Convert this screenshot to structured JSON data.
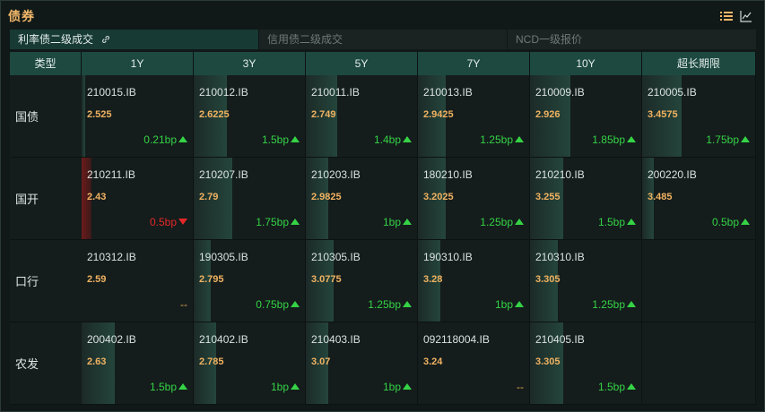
{
  "header": {
    "title": "债券",
    "icons": [
      "list-icon",
      "line-chart-icon"
    ]
  },
  "tabs": [
    {
      "label": "利率债二级成交",
      "active": true,
      "icon": "link-icon"
    },
    {
      "label": "信用债二级成交",
      "active": false
    },
    {
      "label": "NCD一级报价",
      "active": false
    }
  ],
  "columns": [
    "类型",
    "1Y",
    "3Y",
    "5Y",
    "7Y",
    "10Y",
    "超长期限"
  ],
  "rows": [
    {
      "label": "国债",
      "cells": [
        {
          "code": "210015.IB",
          "yield": "2.525",
          "change": "0.21bp",
          "dir": "up",
          "level": 0.03
        },
        {
          "code": "210012.IB",
          "yield": "2.6225",
          "change": "1.5bp",
          "dir": "up",
          "level": 0.3
        },
        {
          "code": "210011.IB",
          "yield": "2.749",
          "change": "1.4bp",
          "dir": "up",
          "level": 0.28
        },
        {
          "code": "210013.IB",
          "yield": "2.9425",
          "change": "1.25bp",
          "dir": "up",
          "level": 0.25
        },
        {
          "code": "210009.IB",
          "yield": "2.926",
          "change": "1.85bp",
          "dir": "up",
          "level": 0.36
        },
        {
          "code": "210005.IB",
          "yield": "3.4575",
          "change": "1.75bp",
          "dir": "up",
          "level": 0.35
        }
      ]
    },
    {
      "label": "国开",
      "cells": [
        {
          "code": "210211.IB",
          "yield": "2.43",
          "change": "0.5bp",
          "dir": "down",
          "level": 0.09
        },
        {
          "code": "210207.IB",
          "yield": "2.79",
          "change": "1.75bp",
          "dir": "up",
          "level": 0.35
        },
        {
          "code": "210203.IB",
          "yield": "2.9825",
          "change": "1bp",
          "dir": "up",
          "level": 0.2
        },
        {
          "code": "180210.IB",
          "yield": "3.2025",
          "change": "1.25bp",
          "dir": "up",
          "level": 0.25
        },
        {
          "code": "210210.IB",
          "yield": "3.255",
          "change": "1.5bp",
          "dir": "up",
          "level": 0.3
        },
        {
          "code": "200220.IB",
          "yield": "3.485",
          "change": "0.5bp",
          "dir": "up",
          "level": 0.1
        }
      ]
    },
    {
      "label": "口行",
      "cells": [
        {
          "code": "210312.IB",
          "yield": "2.59",
          "change": "--",
          "dir": "flat",
          "level": 0
        },
        {
          "code": "190305.IB",
          "yield": "2.795",
          "change": "0.75bp",
          "dir": "up",
          "level": 0.15
        },
        {
          "code": "210305.IB",
          "yield": "3.0775",
          "change": "1.25bp",
          "dir": "up",
          "level": 0.25
        },
        {
          "code": "190310.IB",
          "yield": "3.28",
          "change": "1bp",
          "dir": "up",
          "level": 0.2
        },
        {
          "code": "210310.IB",
          "yield": "3.305",
          "change": "1.25bp",
          "dir": "up",
          "level": 0.25
        },
        null
      ]
    },
    {
      "label": "农发",
      "cells": [
        {
          "code": "200402.IB",
          "yield": "2.63",
          "change": "1.5bp",
          "dir": "up",
          "level": 0.3
        },
        {
          "code": "210402.IB",
          "yield": "2.785",
          "change": "1bp",
          "dir": "up",
          "level": 0.2
        },
        {
          "code": "210403.IB",
          "yield": "3.07",
          "change": "1bp",
          "dir": "up",
          "level": 0.2
        },
        {
          "code": "092118004.IB",
          "yield": "3.24",
          "change": "--",
          "dir": "flat",
          "level": 0
        },
        {
          "code": "210405.IB",
          "yield": "3.305",
          "change": "1.5bp",
          "dir": "up",
          "level": 0.3
        },
        null
      ]
    }
  ],
  "colors": {
    "accent_title": "#f2b86a",
    "header_bg": "#1d4940",
    "up": "#35d345",
    "down": "#e52727",
    "flat": "#e0a64e",
    "yield": "#f0b261"
  }
}
